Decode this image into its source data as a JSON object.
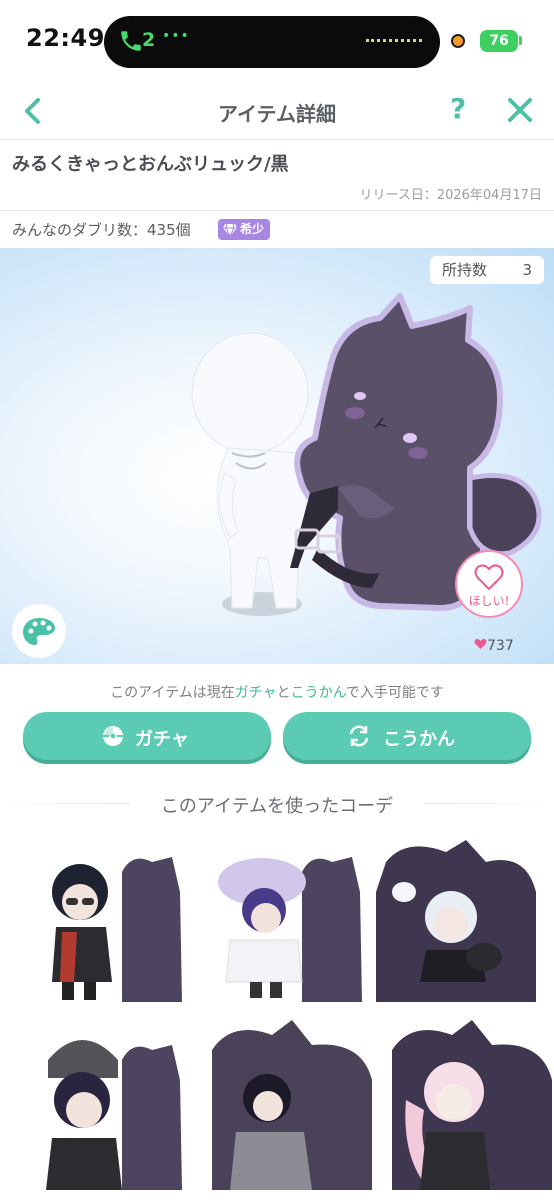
{
  "status_bar": {
    "time": "22:49",
    "call_count": "2",
    "battery": "76"
  },
  "nav": {
    "title": "アイテム詳細",
    "help_label": "?"
  },
  "item": {
    "name": "みるくきゃっとおんぶリュック/黒",
    "release_date": "リリース日：2026年04月17日",
    "duplicates": "みんなのダブリ数：435個",
    "rarity_badge": "希少"
  },
  "preview": {
    "owned_label": "所持数",
    "owned_count": "3",
    "want_label": "ほしい!",
    "likes": "737"
  },
  "availability": {
    "prefix": "このアイテムは現在",
    "gacha_word": "ガチャ",
    "middle": "と",
    "trade_word": "こうかん",
    "suffix": "で入手可能です"
  },
  "buttons": {
    "gacha": "ガチャ",
    "trade": "こうかん"
  },
  "coordinates": {
    "title": "このアイテムを使ったコーデ"
  },
  "colors": {
    "accent": "#5ccbb4",
    "rare": "#a886e3",
    "heart": "#e95a8f"
  }
}
